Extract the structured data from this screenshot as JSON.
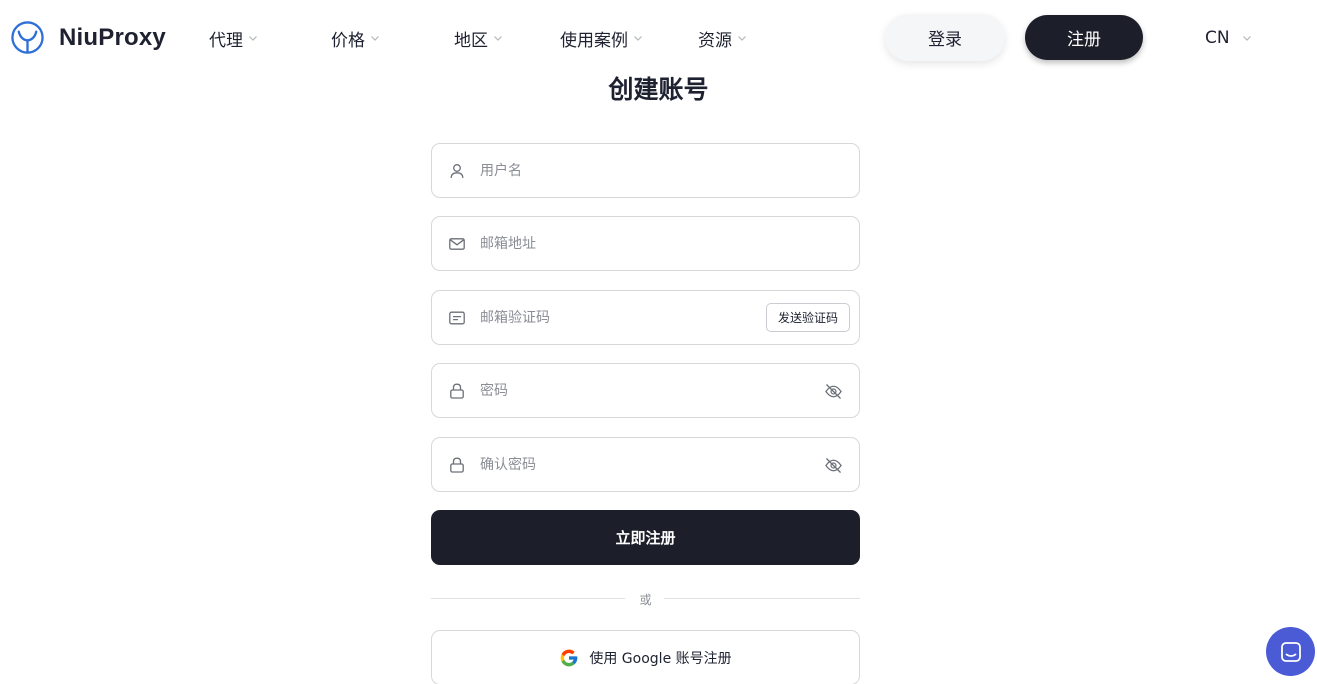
{
  "header": {
    "brand": "NiuProxy",
    "nav": [
      {
        "label": "代理"
      },
      {
        "label": "价格"
      },
      {
        "label": "地区"
      },
      {
        "label": "使用案例"
      },
      {
        "label": "资源"
      }
    ],
    "login_label": "登录",
    "register_label": "注册",
    "language": "CN"
  },
  "form": {
    "title": "创建账号",
    "username_placeholder": "用户名",
    "email_placeholder": "邮箱地址",
    "code_placeholder": "邮箱验证码",
    "send_code_label": "发送验证码",
    "password_placeholder": "密码",
    "confirm_password_placeholder": "确认密码",
    "submit_label": "立即注册",
    "divider_text": "或",
    "google_label": "使用 Google 账号注册"
  },
  "colors": {
    "primary_dark": "#1c1f2a",
    "logo_blue": "#2f6fd8",
    "chat_blue": "#4b5bd6"
  },
  "icons": {
    "logo": "niuproxy-logo-icon",
    "username": "user-icon",
    "email": "mail-icon",
    "code": "message-code-icon",
    "password": "lock-icon",
    "visibility": "eye-off-icon",
    "google": "google-icon",
    "chat": "chat-icon"
  }
}
